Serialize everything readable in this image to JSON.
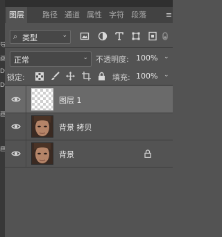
{
  "panel": {
    "tabs": [
      {
        "label": "图层",
        "active": true
      },
      {
        "label": "路径",
        "active": false
      },
      {
        "label": "通道",
        "active": false
      },
      {
        "label": "属性",
        "active": false
      },
      {
        "label": "字符",
        "active": false
      },
      {
        "label": "段落",
        "active": false
      }
    ],
    "menu_icon": "≡"
  },
  "left_strip_glyphs": [
    "导",
    "画",
    "D",
    "D",
    "画",
    "画"
  ],
  "filter": {
    "search_icon": "⌕",
    "kind_label": "类型",
    "icons": [
      "image-filter-icon",
      "adjustment-filter-icon",
      "type-filter-icon",
      "shape-filter-icon",
      "smart-object-filter-icon",
      "filter-toggle-icon"
    ]
  },
  "blend": {
    "mode": "正常",
    "opacity_label": "不透明度:",
    "opacity_value": "100%"
  },
  "lock": {
    "label": "锁定:",
    "icons": [
      "lock-transparent-pixels-icon",
      "lock-image-pixels-icon",
      "lock-position-icon",
      "lock-artboard-icon",
      "lock-all-icon"
    ],
    "fill_label": "填充:",
    "fill_value": "100%"
  },
  "layers": [
    {
      "name": "图层 1",
      "thumb": "transparent",
      "selected": true,
      "locked": false
    },
    {
      "name": "背景 拷贝",
      "thumb": "photo",
      "selected": false,
      "locked": false
    },
    {
      "name": "背景",
      "thumb": "photo",
      "selected": false,
      "locked": true
    }
  ],
  "colors": {
    "panel_bg": "#535353",
    "tabbar_bg": "#424242",
    "selected_row": "#6a6a6a"
  }
}
